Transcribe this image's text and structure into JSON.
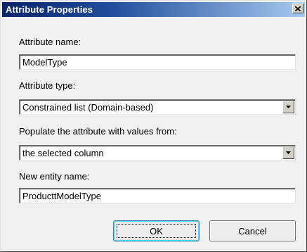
{
  "window": {
    "title": "Attribute Properties",
    "close_icon": "close-icon"
  },
  "fields": {
    "attribute_name_label": "Attribute name:",
    "attribute_name_value": "ModelType",
    "attribute_type_label": "Attribute type:",
    "attribute_type_value": "Constrained list (Domain-based)",
    "populate_label": "Populate the attribute with values from:",
    "populate_value": "the selected column",
    "new_entity_label": "New entity name:",
    "new_entity_value": "ProducttModelType"
  },
  "buttons": {
    "ok_label": "OK",
    "cancel_label": "Cancel"
  },
  "colors": {
    "titlebar_start": "#0a246a",
    "titlebar_end": "#a6caf0",
    "dialog_bg": "#f0f0f0"
  }
}
